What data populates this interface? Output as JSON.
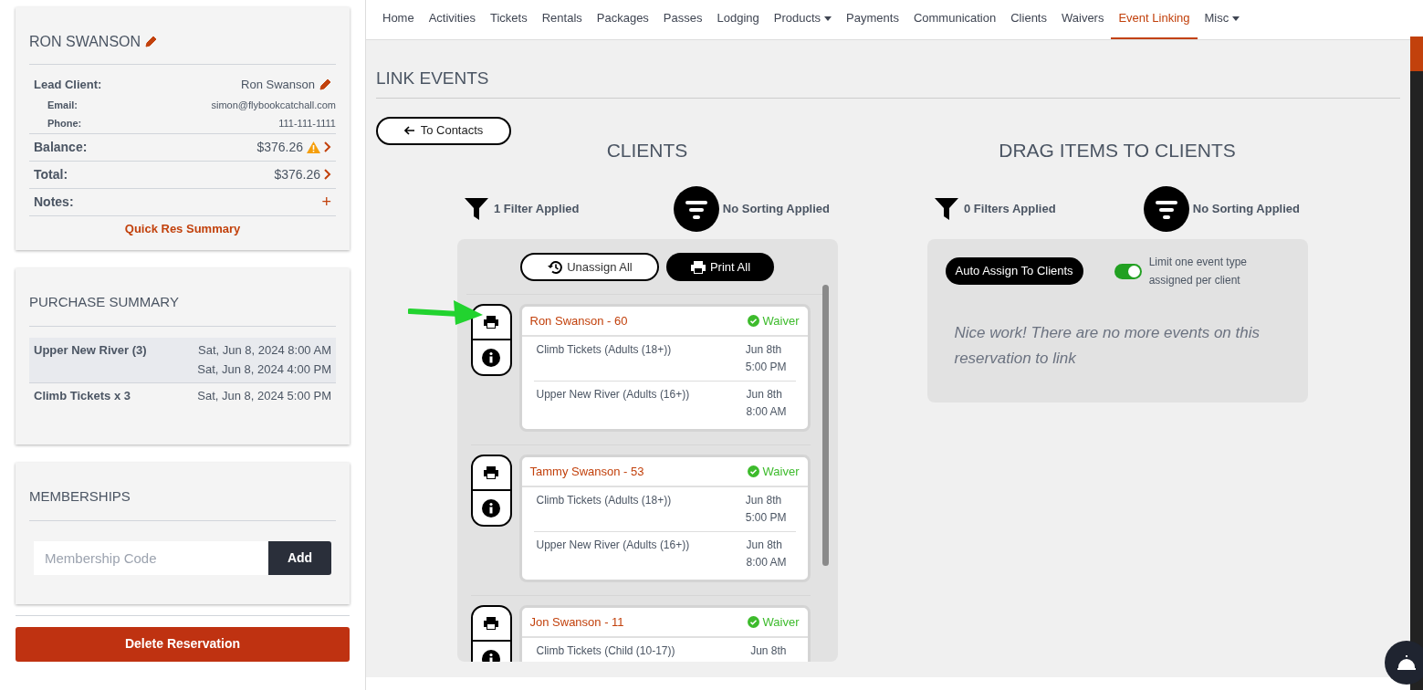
{
  "reservation": {
    "title": "RON SWANSON",
    "details": [
      {
        "kind": "main",
        "label": "Lead Client:",
        "value": "Ron Swanson"
      },
      {
        "kind": "sub",
        "label": "Email:",
        "value": "simon@flybookcatchall.com"
      },
      {
        "kind": "sub",
        "label": "Phone:",
        "value": "111-111-1111"
      },
      {
        "kind": "money",
        "label": "Balance:",
        "value": "$376.26",
        "warning": true
      },
      {
        "kind": "money",
        "label": "Total:",
        "value": "$376.26",
        "warning": false
      },
      {
        "kind": "notes",
        "label": "Notes:",
        "action": "+"
      }
    ],
    "link": "Quick Res Summary"
  },
  "purchase_summary": {
    "title": "PURCHASE SUMMARY",
    "rows": [
      {
        "item": "Upper New River (3)",
        "times": [
          "Sat, Jun 8, 2024 8:00 AM",
          "Sat, Jun 8, 2024 4:00 PM"
        ],
        "selected": true
      },
      {
        "item": "Climb Tickets x 3",
        "times": [
          "Sat, Jun 8, 2024 5:00 PM"
        ],
        "selected": false
      }
    ]
  },
  "memberships": {
    "title": "MEMBERSHIPS",
    "placeholder": "Membership Code",
    "button": "Add"
  },
  "delete_button": "Delete Reservation",
  "nav": [
    {
      "label": "Home",
      "selected": false
    },
    {
      "label": "Activities",
      "selected": false
    },
    {
      "label": "Tickets",
      "selected": false
    },
    {
      "label": "Rentals",
      "selected": false
    },
    {
      "label": "Packages",
      "selected": false
    },
    {
      "label": "Passes",
      "selected": false
    },
    {
      "label": "Lodging",
      "selected": false
    },
    {
      "label": "Products",
      "selected": false,
      "dropdown": true
    },
    {
      "label": "Payments",
      "selected": false
    },
    {
      "label": "Communication",
      "selected": false
    },
    {
      "label": "Clients",
      "selected": false
    },
    {
      "label": "Waivers",
      "selected": false
    },
    {
      "label": "Event Linking",
      "selected": true
    },
    {
      "label": "Misc",
      "selected": false,
      "dropdown": true
    }
  ],
  "page_title": "LINK EVENTS",
  "back_button": "To Contacts",
  "clients_panel": {
    "title": "CLIENTS",
    "filter": "1 Filter Applied",
    "sorting": "No Sorting Applied",
    "unassign": "Unassign All",
    "print": "Print All",
    "clients": [
      {
        "name": "Ron Swanson - 60",
        "waiver": "Waiver",
        "items": [
          {
            "name": "Climb Tickets (Adults (18+))",
            "date": "Jun 8th",
            "time": "5:00 PM"
          },
          {
            "name": "Upper New River (Adults (16+))",
            "date": "Jun 8th",
            "time": "8:00 AM"
          }
        ]
      },
      {
        "name": "Tammy Swanson - 53",
        "waiver": "Waiver",
        "items": [
          {
            "name": "Climb Tickets (Adults (18+))",
            "date": "Jun 8th",
            "time": "5:00 PM"
          },
          {
            "name": "Upper New River (Adults (16+))",
            "date": "Jun 8th",
            "time": "8:00 AM"
          }
        ]
      },
      {
        "name": "Jon Swanson - 11",
        "waiver": "Waiver",
        "items": [
          {
            "name": "Climb Tickets (Child (10-17))",
            "date": "Jun 8th"
          }
        ]
      }
    ]
  },
  "items_panel": {
    "title": "DRAG ITEMS TO CLIENTS",
    "filter": "0 Filters Applied",
    "sorting": "No Sorting Applied",
    "auto_assign": "Auto Assign To Clients",
    "limit_toggle": {
      "label": "Limit one event type assigned per client",
      "on": true
    },
    "empty_message": "Nice work! There are no more events on this reservation to link"
  }
}
